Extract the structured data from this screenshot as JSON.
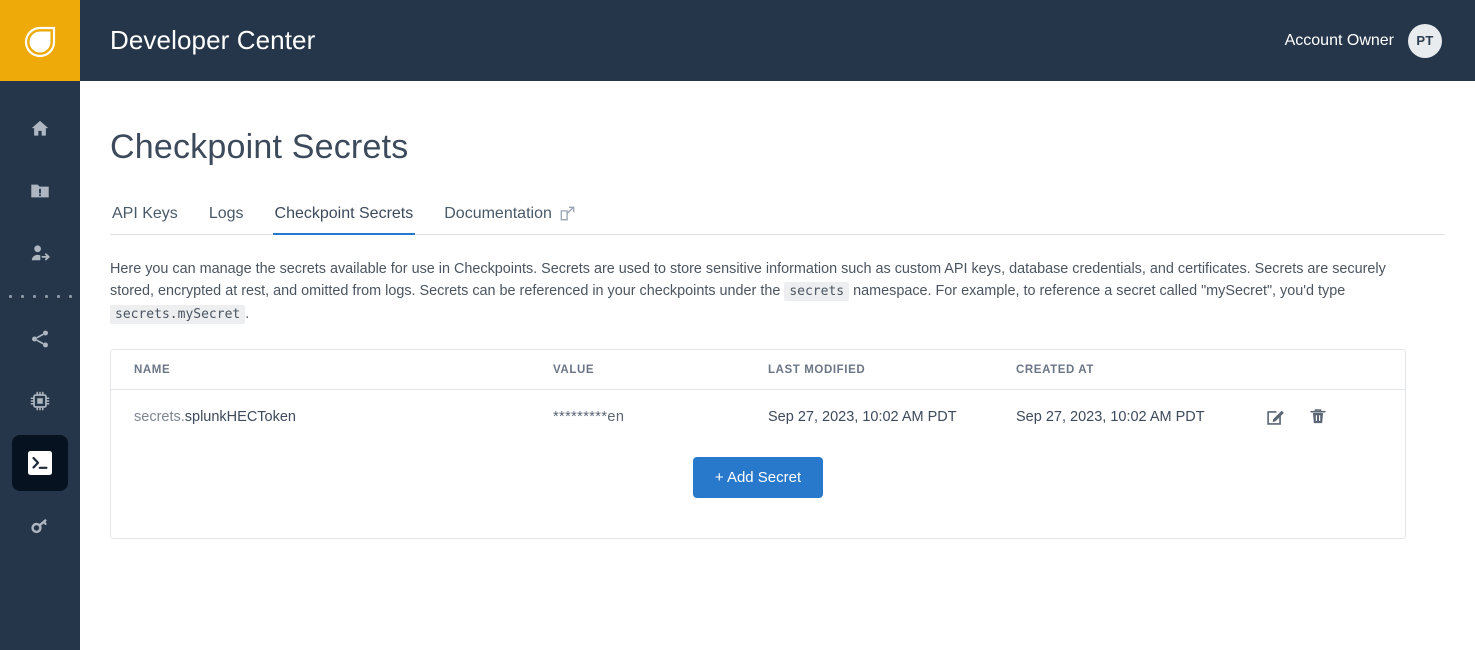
{
  "brand": {
    "logo_icon": "drop-logo-icon",
    "logo_color": "#edaa08",
    "header_bg": "#25364a"
  },
  "header": {
    "title": "Developer Center",
    "account_label": "Account Owner",
    "avatar_initials": "PT"
  },
  "sidebar": {
    "items": [
      {
        "name": "home",
        "icon": "home-icon",
        "active": false
      },
      {
        "name": "projects",
        "icon": "folder-alert-icon",
        "active": false
      },
      {
        "name": "user-access",
        "icon": "user-arrow-icon",
        "active": false
      },
      {
        "name": "separator",
        "icon": "dotted-separator",
        "active": false
      },
      {
        "name": "integrations",
        "icon": "share-nodes-icon",
        "active": false
      },
      {
        "name": "compute",
        "icon": "chip-icon",
        "active": false
      },
      {
        "name": "developer-center",
        "icon": "terminal-icon",
        "active": true
      },
      {
        "name": "credentials",
        "icon": "key-icon",
        "active": false
      }
    ]
  },
  "page": {
    "title": "Checkpoint Secrets"
  },
  "tabs": [
    {
      "label": "API Keys",
      "active": false,
      "external": false
    },
    {
      "label": "Logs",
      "active": false,
      "external": false
    },
    {
      "label": "Checkpoint Secrets",
      "active": true,
      "external": false
    },
    {
      "label": "Documentation",
      "active": false,
      "external": true
    }
  ],
  "description": {
    "part1": "Here you can manage the secrets available for use in Checkpoints. Secrets are used to store sensitive information such as custom API keys, database credentials, and certificates. Secrets are securely stored, encrypted at rest, and omitted from logs. Secrets can be referenced in your checkpoints under the ",
    "code1": "secrets",
    "part2": " namespace. For example, to reference a secret called \"mySecret\", you'd type ",
    "code2": "secrets.mySecret",
    "part3": "."
  },
  "table": {
    "columns": [
      "NAME",
      "VALUE",
      "LAST MODIFIED",
      "CREATED AT"
    ],
    "rows": [
      {
        "name_namespace": "secrets.",
        "name_key": "splunkHECToken",
        "value": "*********en",
        "last_modified": "Sep 27, 2023, 10:02 AM PDT",
        "created_at": "Sep 27, 2023, 10:02 AM PDT",
        "edit_icon": "edit-pencil-icon",
        "delete_icon": "trash-icon"
      }
    ]
  },
  "actions": {
    "add_secret_label": "+ Add Secret",
    "primary_color": "#2878cc"
  }
}
